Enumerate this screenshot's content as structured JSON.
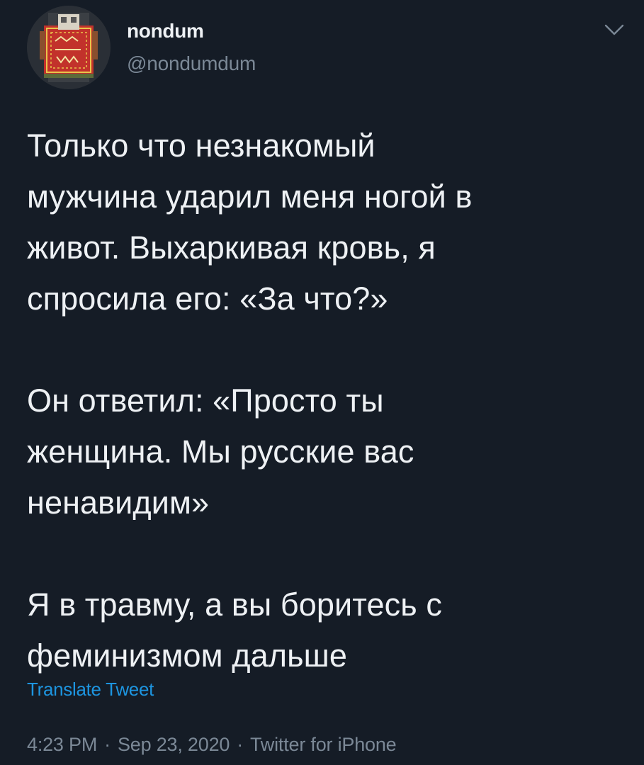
{
  "author": {
    "display_name": "nondum",
    "handle": "@nondumdum",
    "avatar_icon": "patterned-rug-avatar"
  },
  "menu_icon": "chevron-down-icon",
  "tweet": {
    "paragraphs": [
      "Только что незнакомый\nмужчина ударил меня ногой в\nживот. Выхаркивая кровь, я\nспросила его: «За что?»",
      "Он ответил: «Просто ты\nженщина. Мы русские вас\nненавидим»",
      "Я в травму, а вы боритесь с\nфеминизмом дальше"
    ]
  },
  "translate_label": "Translate Tweet",
  "meta": {
    "time": "4:23 PM",
    "separator": "·",
    "date": "Sep 23, 2020",
    "source": "Twitter for iPhone"
  },
  "colors": {
    "background": "#151c26",
    "text": "#eef1f4",
    "secondary": "#7b8896",
    "link": "#1d95e0"
  }
}
